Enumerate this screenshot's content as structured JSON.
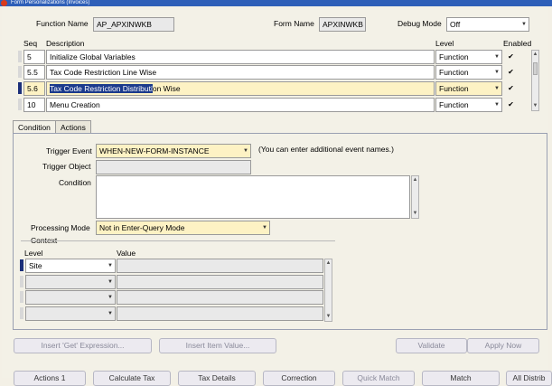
{
  "window": {
    "title": "Form Personalizations (Invoices)"
  },
  "header": {
    "function_name_label": "Function Name",
    "function_name_value": "AP_APXINWKB",
    "form_name_label": "Form Name",
    "form_name_value": "APXINWKB",
    "debug_mode_label": "Debug Mode",
    "debug_mode_value": "Off"
  },
  "rules": {
    "col_seq": "Seq",
    "col_description": "Description",
    "col_level": "Level",
    "col_enabled": "Enabled",
    "rows": [
      {
        "seq": "5",
        "description": "Initialize Global Variables",
        "description_highlight": "",
        "level": "Function",
        "enabled": "✔"
      },
      {
        "seq": "5.5",
        "description": "Tax Code Restriction Line Wise",
        "description_highlight": "",
        "level": "Function",
        "enabled": "✔"
      },
      {
        "seq": "5.6",
        "description": "on Wise",
        "description_highlight": "Tax Code Restriction Distributi",
        "level": "Function",
        "enabled": "✔"
      },
      {
        "seq": "10",
        "description": "Menu Creation",
        "description_highlight": "",
        "level": "Function",
        "enabled": "✔"
      }
    ]
  },
  "tabs": {
    "condition": "Condition",
    "actions": "Actions"
  },
  "condition": {
    "trigger_event_label": "Trigger Event",
    "trigger_event_value": "WHEN-NEW-FORM-INSTANCE",
    "trigger_event_hint": "(You can enter additional event names.)",
    "trigger_object_label": "Trigger Object",
    "trigger_object_value": "",
    "condition_label": "Condition",
    "condition_value": "",
    "processing_mode_label": "Processing Mode",
    "processing_mode_value": "Not in Enter-Query Mode",
    "context_label": "Context",
    "level_col": "Level",
    "value_col": "Value",
    "context_rows": [
      {
        "level": "Site",
        "value": ""
      },
      {
        "level": "",
        "value": ""
      },
      {
        "level": "",
        "value": ""
      },
      {
        "level": "",
        "value": ""
      }
    ]
  },
  "buttons": {
    "insert_get": "Insert 'Get' Expression...",
    "insert_item": "Insert Item Value...",
    "validate": "Validate",
    "apply_now": "Apply Now"
  },
  "bottom_buttons": [
    "Actions 1",
    "Calculate Tax",
    "Tax Details",
    "Correction",
    "Quick Match",
    "Match",
    "All Distrib"
  ]
}
